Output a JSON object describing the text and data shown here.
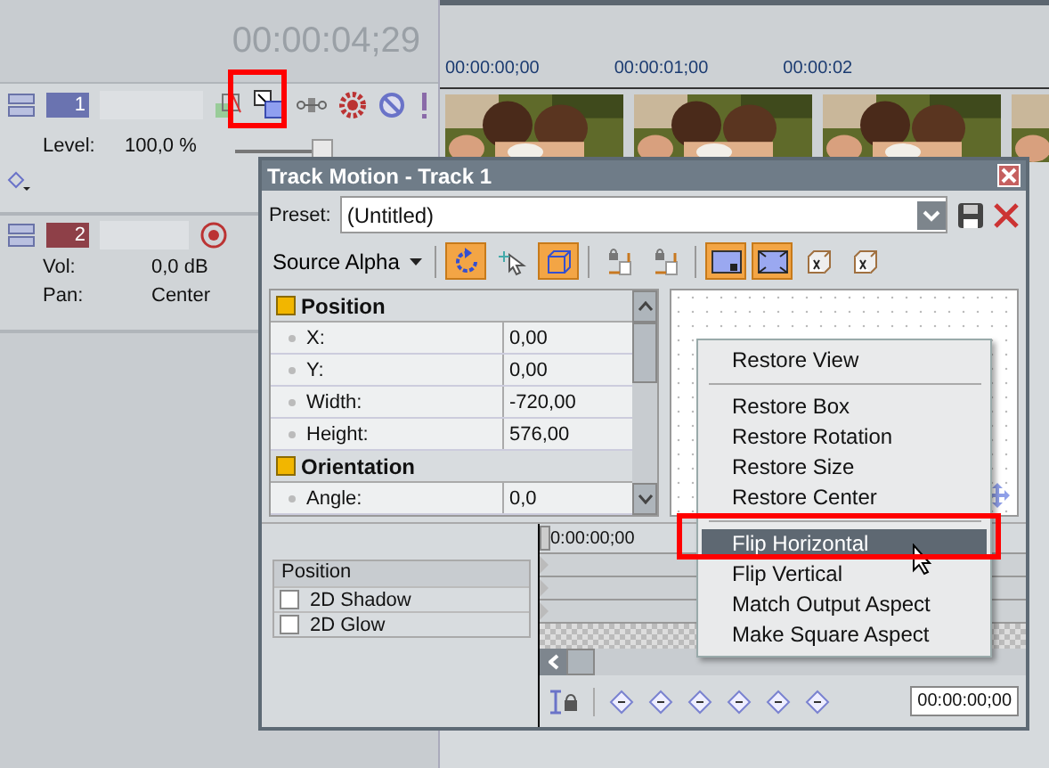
{
  "timecode": "00:00:04;29",
  "tracks": [
    {
      "kind": "video",
      "number": "1",
      "level_label": "Level:",
      "level_value": "100,0 %",
      "level": 1.0
    },
    {
      "kind": "audio",
      "number": "2",
      "vol_label": "Vol:",
      "vol_value": "0,0 dB",
      "pan_label": "Pan:",
      "pan_value": "Center"
    }
  ],
  "ruler": [
    "00:00:00;00",
    "00:00:01;00",
    "00:00:02"
  ],
  "dialog": {
    "title": "Track Motion - Track 1",
    "preset_label": "Preset:",
    "preset": "(Untitled)",
    "source_alpha": "Source Alpha",
    "toolbar": [
      {
        "kind": "rotate",
        "selected": true
      },
      {
        "kind": "pointer",
        "selected": false
      },
      {
        "kind": "cube",
        "selected": true
      },
      {
        "kind": "sep"
      },
      {
        "kind": "lockx",
        "selected": false
      },
      {
        "kind": "locky",
        "selected": false
      },
      {
        "kind": "sep"
      },
      {
        "kind": "boxarrow",
        "selected": true
      },
      {
        "kind": "boxfull",
        "selected": true
      },
      {
        "kind": "cubex",
        "selected": false
      },
      {
        "kind": "cubey",
        "selected": false
      }
    ],
    "groups": [
      {
        "name": "Position",
        "props": [
          {
            "name": "X:",
            "value": "0,00"
          },
          {
            "name": "Y:",
            "value": "0,00"
          },
          {
            "name": "Width:",
            "value": "-720,00"
          },
          {
            "name": "Height:",
            "value": "576,00"
          }
        ]
      },
      {
        "name": "Orientation",
        "props": [
          {
            "name": "Angle:",
            "value": "0,0"
          }
        ]
      }
    ],
    "effects_header": "Position",
    "effects": [
      {
        "label": "2D Shadow",
        "checked": false
      },
      {
        "label": "2D Glow",
        "checked": false
      }
    ],
    "keyframe_time": "0:00:00;00",
    "cursor_time": "00:00:00;00"
  },
  "menu": [
    {
      "kind": "item",
      "label": "Restore View",
      "selected": false
    },
    {
      "kind": "sep"
    },
    {
      "kind": "item",
      "label": "Restore Box",
      "selected": false
    },
    {
      "kind": "item",
      "label": "Restore Rotation",
      "selected": false
    },
    {
      "kind": "item",
      "label": "Restore Size",
      "selected": false
    },
    {
      "kind": "item",
      "label": "Restore Center",
      "selected": false
    },
    {
      "kind": "sep"
    },
    {
      "kind": "item",
      "label": "Flip Horizontal",
      "selected": true
    },
    {
      "kind": "item",
      "label": "Flip Vertical",
      "selected": false
    },
    {
      "kind": "item",
      "label": "Match Output Aspect",
      "selected": false
    },
    {
      "kind": "item",
      "label": "Make Square Aspect",
      "selected": false
    }
  ]
}
